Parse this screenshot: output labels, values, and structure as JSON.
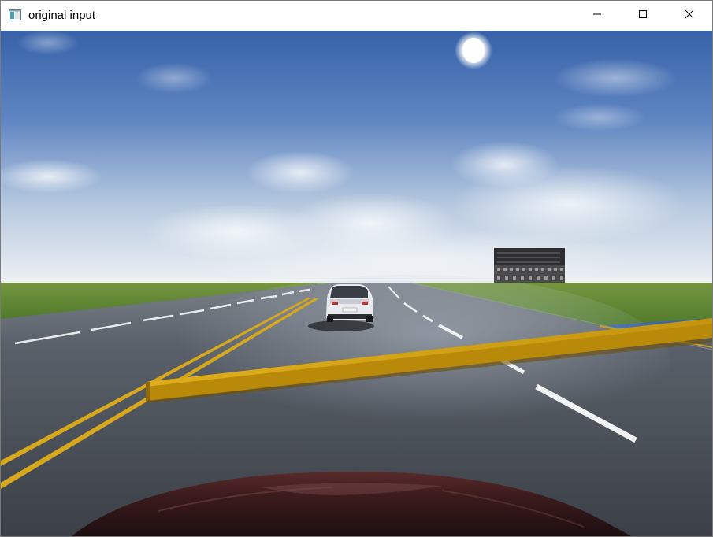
{
  "window": {
    "title": "original input",
    "controls": {
      "minimize": "minimize-icon",
      "maximize": "maximize-icon",
      "close": "close-icon"
    }
  },
  "scene": {
    "description_icons": [
      "sun",
      "sky",
      "grass",
      "road",
      "car",
      "barrier",
      "building",
      "ego-car-hood"
    ],
    "colors": {
      "sky_top": "#3a63a8",
      "sky_horizon": "#e6ecf2",
      "grass": "#5f8a33",
      "road": "#4a4f57",
      "barrier": "#d4a00c",
      "lane_yellow": "#e0b020",
      "hood": "#3b1c1e"
    }
  }
}
